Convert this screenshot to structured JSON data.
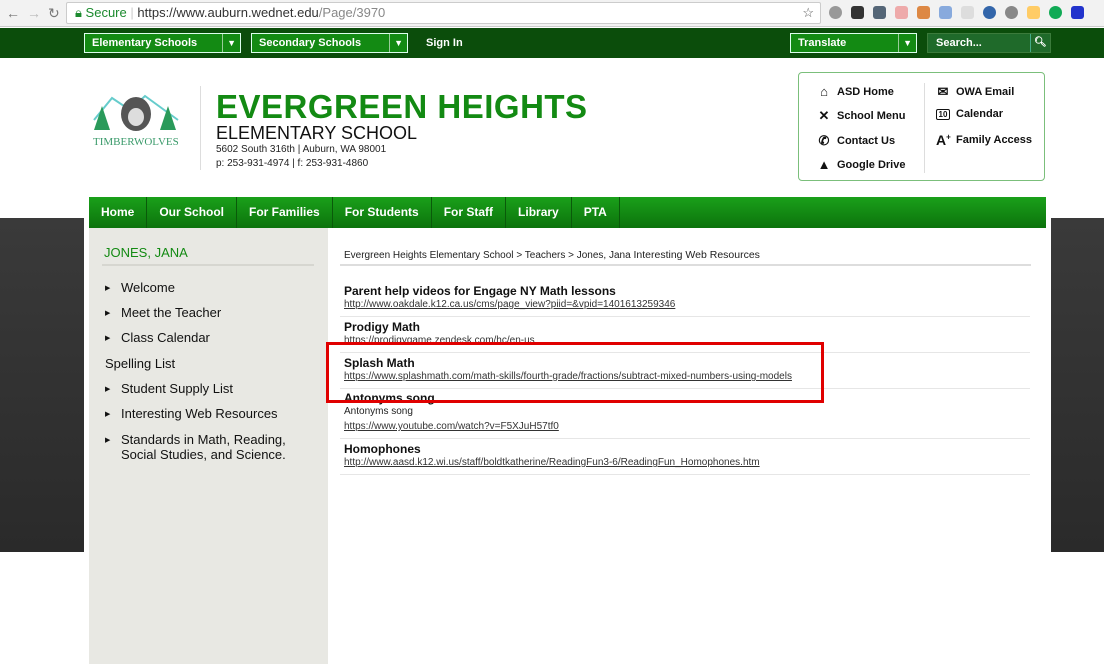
{
  "browser": {
    "secure_label": "Secure",
    "url_host": "https://www.auburn.wednet.edu",
    "url_path": "/Page/3970"
  },
  "topnav": {
    "elementary": "Elementary Schools",
    "secondary": "Secondary Schools",
    "signin": "Sign In",
    "translate": "Translate",
    "search_placeholder": "Search..."
  },
  "header": {
    "logo_text": "TIMBERWOLVES",
    "school_name": "EVERGREEN HEIGHTS",
    "school_type": "ELEMENTARY SCHOOL",
    "address": "5602 South 316th | Auburn, WA 98001",
    "phone": "p: 253-931-4974 | f: 253-931-4860"
  },
  "quick_links": [
    {
      "label": "ASD Home",
      "icon": "home-icon"
    },
    {
      "label": "School Menu",
      "icon": "utensils-icon"
    },
    {
      "label": "Contact Us",
      "icon": "phone-icon"
    },
    {
      "label": "Google Drive",
      "icon": "google-drive-icon"
    },
    {
      "label": "OWA Email",
      "icon": "envelope-icon"
    },
    {
      "label": "Calendar",
      "icon": "calendar-icon"
    },
    {
      "label": "Family Access",
      "icon": "a-plus-icon"
    }
  ],
  "main_nav": [
    "Home",
    "Our School",
    "For Families",
    "For Students",
    "For Staff",
    "Library",
    "PTA"
  ],
  "sidebar": {
    "title": "JONES, JANA",
    "items": [
      "Welcome",
      "Meet the Teacher",
      "Class Calendar",
      "Spelling List",
      "Student Supply List",
      "Interesting Web Resources",
      "Standards in Math, Reading,",
      "Social Studies, and Science."
    ]
  },
  "breadcrumb": {
    "a": "Evergreen Heights Elementary School",
    "b": "Teachers",
    "c": "Jones, Jana",
    "current": "Interesting Web Resources",
    "sep": ">"
  },
  "resources": [
    {
      "title": "Parent help videos for Engage NY Math lessons",
      "url": "http://www.oakdale.k12.ca.us/cms/page_view?piid=&vpid=1401613259346"
    },
    {
      "title": "Prodigy Math",
      "url": "https://prodigygame.zendesk.com/hc/en-us"
    },
    {
      "title": "Splash Math",
      "url": "https://www.splashmath.com/math-skills/fourth-grade/fractions/subtract-mixed-numbers-using-models"
    },
    {
      "title": "Antonyms song",
      "desc": "Antonyms song",
      "url": "https://www.youtube.com/watch?v=F5XJuH57tf0"
    },
    {
      "title": "Homophones",
      "url": "http://www.aasd.k12.wi.us/staff/boldtkatherine/ReadingFun3-6/ReadingFun_Homophones.htm"
    }
  ],
  "colors": {
    "brand_green": "#138a13",
    "dark_green": "#0b4d0b",
    "highlight": "#e00000"
  }
}
